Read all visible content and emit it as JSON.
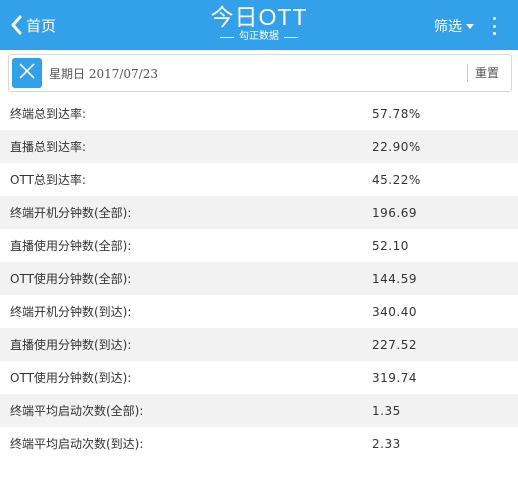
{
  "header": {
    "back_label": "首页",
    "logo_title": "今日OTT",
    "logo_subtitle": "勾正数据",
    "filter_label": "筛选",
    "accent_color": "#33a0ea"
  },
  "datebar": {
    "date": "星期日 2017/07/23",
    "reset_label": "重置"
  },
  "metrics": [
    {
      "label": "终端总到达率:",
      "value": "57.78%"
    },
    {
      "label": "直播总到达率:",
      "value": "22.90%"
    },
    {
      "label": "OTT总到达率:",
      "value": "45.22%"
    },
    {
      "label": "终端开机分钟数(全部):",
      "value": "196.69"
    },
    {
      "label": "直播使用分钟数(全部):",
      "value": "52.10"
    },
    {
      "label": "OTT使用分钟数(全部):",
      "value": "144.59"
    },
    {
      "label": "终端开机分钟数(到达):",
      "value": "340.40"
    },
    {
      "label": "直播使用分钟数(到达):",
      "value": "227.52"
    },
    {
      "label": "OTT使用分钟数(到达):",
      "value": "319.74"
    },
    {
      "label": "终端平均启动次数(全部):",
      "value": "1.35"
    },
    {
      "label": "终端平均启动次数(到达):",
      "value": "2.33"
    }
  ]
}
